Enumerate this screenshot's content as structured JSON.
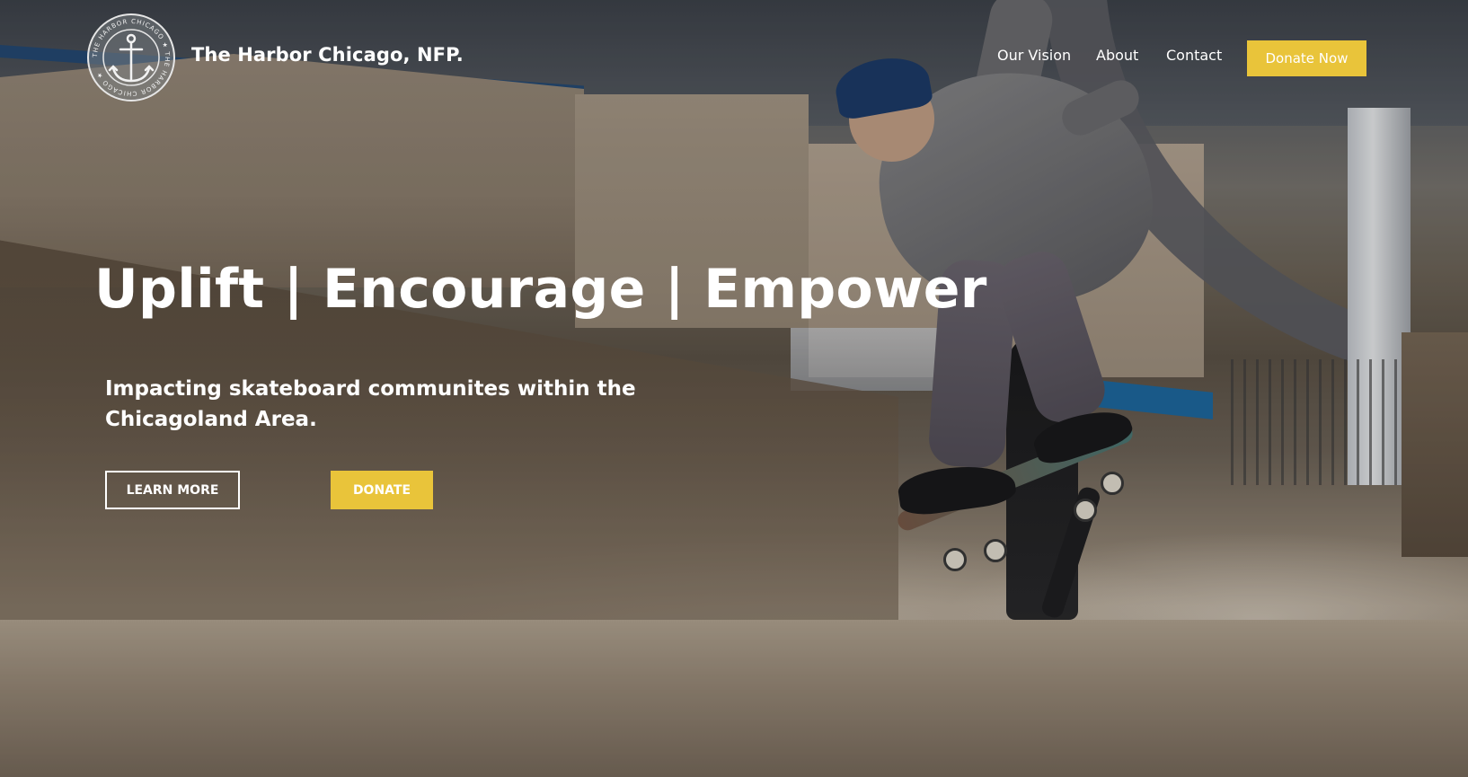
{
  "header": {
    "logo_icon": "anchor-seal-icon",
    "logo_ring_text": "THE HARBOR CHICAGO",
    "brand_name": "The Harbor Chicago, NFP.",
    "nav": [
      {
        "label": "Our Vision"
      },
      {
        "label": "About"
      },
      {
        "label": "Contact"
      }
    ],
    "donate_now_label": "Donate Now"
  },
  "hero": {
    "headline": "Uplift | Encourage | Empower",
    "subheadline": "Impacting skateboard communites within the Chicagoland Area.",
    "learn_more_label": "LEARN MORE",
    "donate_label": "DONATE",
    "background_image": "skateboarder-performing-trick-in-concrete-skatepark"
  },
  "colors": {
    "accent": "#e9c43a",
    "text": "#ffffff"
  }
}
